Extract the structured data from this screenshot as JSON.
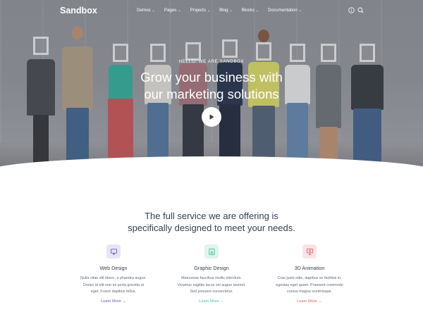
{
  "nav": {
    "logo": "Sandbox",
    "menu": [
      {
        "label": "Demos"
      },
      {
        "label": "Pages"
      },
      {
        "label": "Projects"
      },
      {
        "label": "Blog"
      },
      {
        "label": "Blocks"
      },
      {
        "label": "Documentation"
      }
    ],
    "caret": "⌄",
    "icons": [
      "info-icon",
      "search-icon"
    ]
  },
  "hero": {
    "eyebrow": "HELLO! WE ARE SANDBOX",
    "title_line1": "Grow your business with",
    "title_line2": "our marketing solutions",
    "play_icon": "play-icon"
  },
  "services": {
    "heading_line1": "The full service we are offering is",
    "heading_line2": "specifically designed to meet your needs.",
    "items": [
      {
        "icon": "monitor-icon",
        "title": "Web Design",
        "desc_lines": [
          "Nulla vitae elit libero, a pharetra augue.",
          "Donec id elit non mi porta gravida at",
          "eget. Fusce dapibus tellus."
        ],
        "link": "Learn More →",
        "accent": "#605dba",
        "badge_bg": "#e6e5f5"
      },
      {
        "icon": "design-icon",
        "title": "Graphic Design",
        "desc_lines": [
          "Maecenas faucibus mollis interdum.",
          "Vivamus sagittis lacus vel augue laoreet.",
          "Sed posuere consectetur."
        ],
        "link": "Learn More →",
        "accent": "#45c4a0",
        "badge_bg": "#dff4ec"
      },
      {
        "icon": "animation-icon",
        "title": "3D Animation",
        "desc_lines": [
          "Cras justo odio, dapibus ac facilisis in,",
          "egestas eget quam. Praesent commodo",
          "cursus magna scelerisque."
        ],
        "link": "Learn More →",
        "accent": "#e2626b",
        "badge_bg": "#fbe4e6"
      }
    ]
  }
}
